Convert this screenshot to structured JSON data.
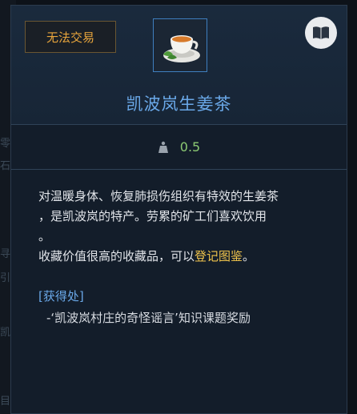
{
  "tooltip": {
    "trade_status": "无法交易",
    "item_name": "凯波岚生姜茶",
    "weight_value": "0.5",
    "description_lines": [
      "对温暖身体、恢复肺损伤组织有特效的生姜茶",
      "，是凯波岚的特产。劳累的矿工们喜欢饮用",
      "。"
    ],
    "collection_text_prefix": "收藏价值很高的收藏品，可以",
    "collection_link": "登记图鉴",
    "collection_text_suffix": "。",
    "source_title": "[获得处]",
    "source_item": "-‘凯波岚村庄的奇怪谣言’知识课题奖励",
    "icons": {
      "item": "tea-cup-icon",
      "book": "book-icon",
      "weight": "weight-icon"
    }
  },
  "background": {
    "fragments": [
      "零",
      "石",
      "寻",
      "引",
      "凯",
      "目"
    ]
  }
}
